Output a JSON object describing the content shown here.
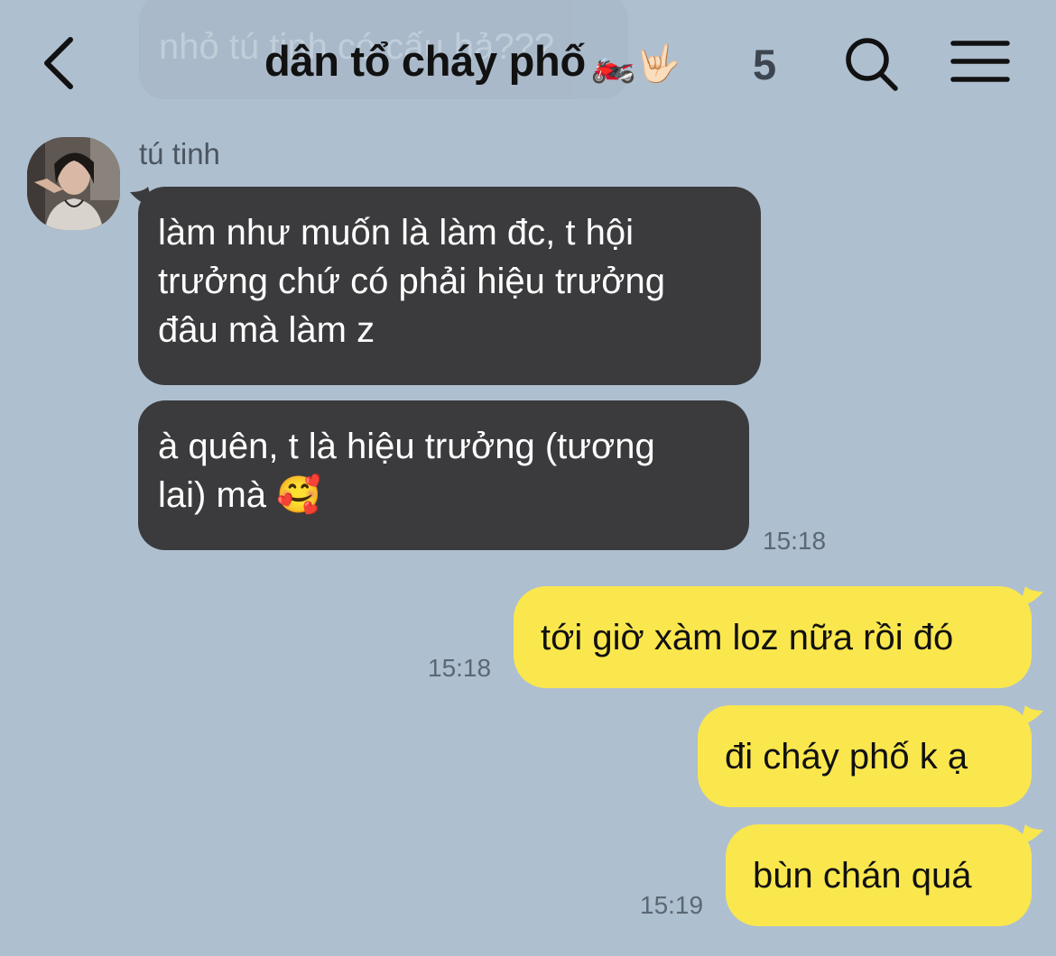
{
  "header": {
    "ghost_message": "nhỏ tú tinh có cấu hả???",
    "title": "dân tổ cháy phố",
    "title_emoji": "🏍️🤟🏻",
    "member_count": "5"
  },
  "icons": {
    "back": "chevron-left-icon",
    "search": "search-icon",
    "menu": "hamburger-menu-icon"
  },
  "colors": {
    "background": "#aebfd0",
    "incoming_bubble": "#3b3b3d",
    "outgoing_bubble": "#fae74e"
  },
  "messages": {
    "incoming": {
      "sender": "tú tinh",
      "bubble1": {
        "line1": "làm như muốn là làm đc, t hội",
        "line2": "trưởng chứ có phải hiệu trưởng",
        "line3": "đâu mà làm z"
      },
      "bubble2": {
        "line1": "à quên, t là hiệu trưởng (tương",
        "line2": "lai) mà 🥰"
      },
      "time": "15:18"
    },
    "outgoing": [
      {
        "text": "tới giờ xàm loz nữa rồi đó",
        "time": "15:18"
      },
      {
        "text": "đi cháy phố k ạ"
      },
      {
        "text": "bùn chán quá",
        "time": "15:19"
      }
    ]
  }
}
